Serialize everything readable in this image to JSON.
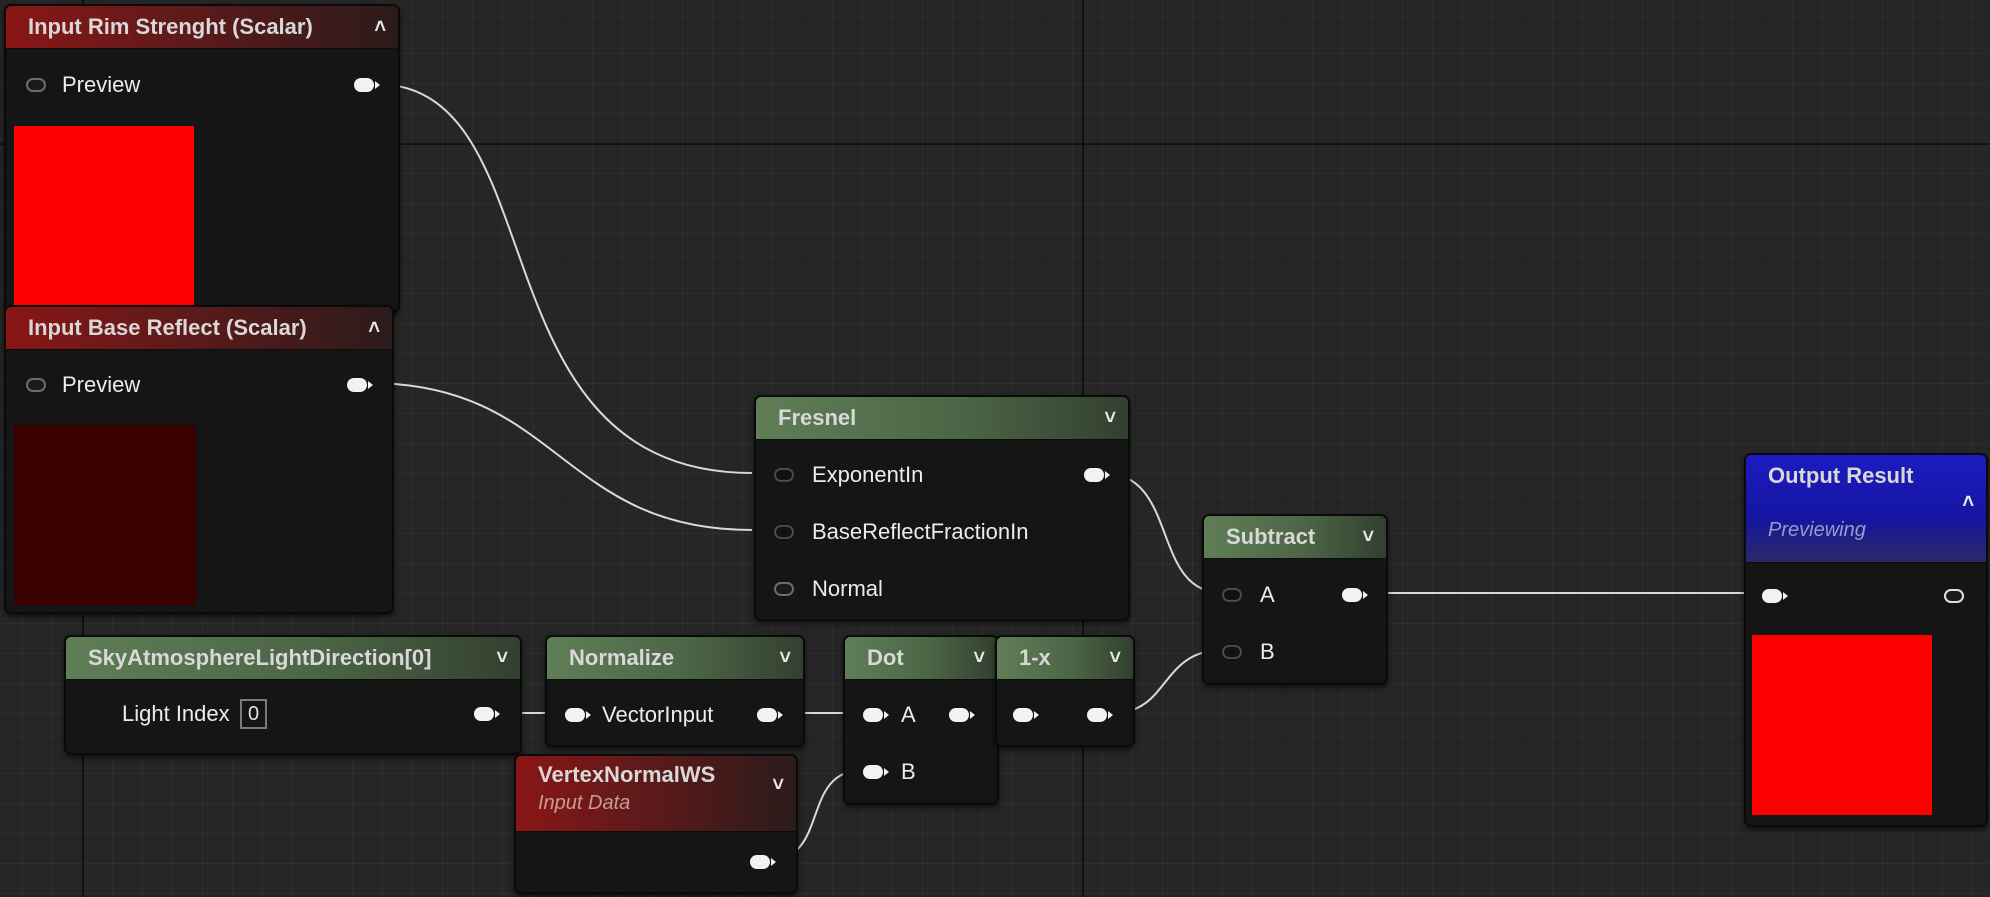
{
  "nodes": {
    "rim": {
      "title": "Input Rim Strenght (Scalar)",
      "preview_label": "Preview",
      "collapse_icon": "chevron-up-icon"
    },
    "base": {
      "title": "Input Base Reflect (Scalar)",
      "preview_label": "Preview",
      "collapse_icon": "chevron-up-icon"
    },
    "fresnel": {
      "title": "Fresnel",
      "pins": [
        "ExponentIn",
        "BaseReflectFractionIn",
        "Normal"
      ],
      "expand_icon": "chevron-down-icon"
    },
    "subtract": {
      "title": "Subtract",
      "pins": [
        "A",
        "B"
      ]
    },
    "output": {
      "title": "Output Result",
      "subtitle": "Previewing"
    },
    "sky": {
      "title": "SkyAtmosphereLightDirection[0]",
      "light_index_label": "Light Index",
      "light_index_value": "0"
    },
    "normalize": {
      "title": "Normalize",
      "pin": "VectorInput"
    },
    "dot": {
      "title": "Dot",
      "pins": [
        "A",
        "B"
      ]
    },
    "oneminus": {
      "title": "1-x"
    },
    "vertex": {
      "title": "VertexNormalWS",
      "subtitle": "Input Data"
    }
  },
  "colors": {
    "header_red": "#8a1616",
    "header_green": "#5f7e56",
    "header_blue": "#1c1cc2",
    "preview_red": "#ff0000",
    "preview_dark_red": "#3a0000",
    "wire": "#d8d8d8"
  }
}
